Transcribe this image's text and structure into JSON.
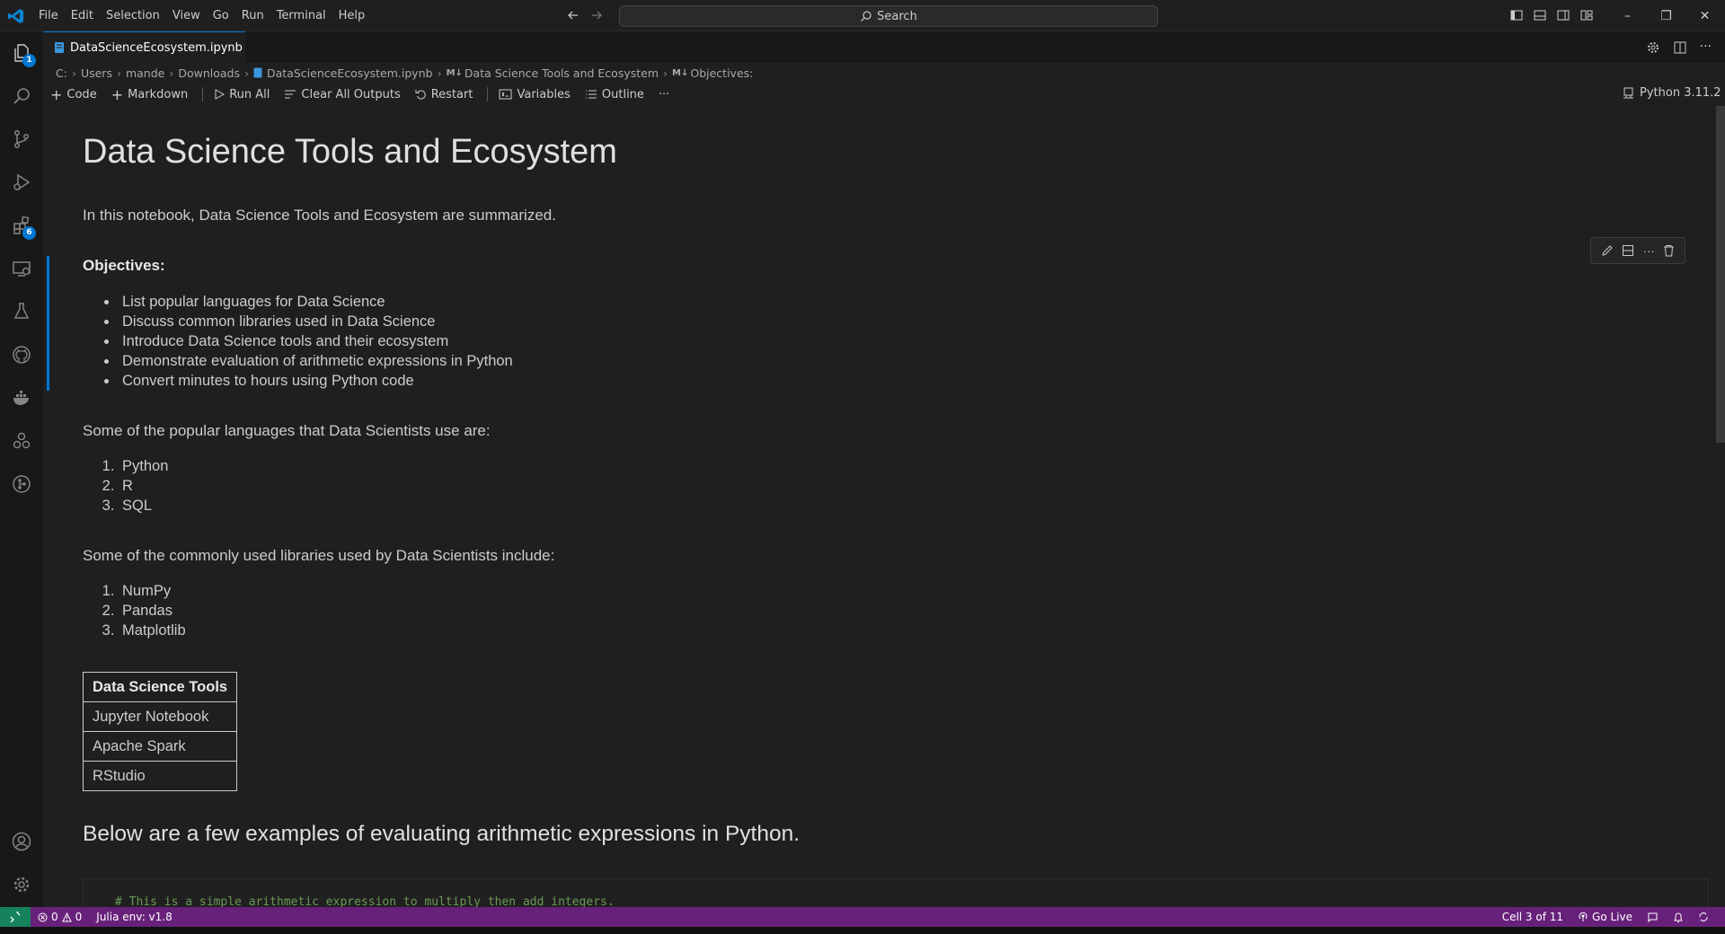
{
  "menu": [
    "File",
    "Edit",
    "Selection",
    "View",
    "Go",
    "Run",
    "Terminal",
    "Help"
  ],
  "search": {
    "label": "Search"
  },
  "window_controls": {
    "minimize": "–",
    "restore": "❐",
    "close": "✕"
  },
  "activity_badges": {
    "explorer": "1",
    "extensions": "6"
  },
  "tab": {
    "filename": "DataScienceEcosystem.ipynb"
  },
  "breadcrumb": [
    "C:",
    "Users",
    "mande",
    "Downloads",
    "DataScienceEcosystem.ipynb",
    "Data Science Tools and Ecosystem",
    "Objectives:"
  ],
  "breadcrumb_md_prefix": "M↓",
  "toolbar": {
    "code": "Code",
    "markdown": "Markdown",
    "run_all": "Run All",
    "clear_outputs": "Clear All Outputs",
    "restart": "Restart",
    "variables": "Variables",
    "outline": "Outline",
    "more": "···"
  },
  "kernel": "Python 3.11.2",
  "notebook": {
    "title": "Data Science Tools and Ecosystem",
    "intro": "In this notebook, Data Science Tools and Ecosystem are summarized.",
    "objectives_heading": "Objectives:",
    "objectives": [
      "List popular languages for Data Science",
      "Discuss common libraries used in Data Science",
      "Introduce Data Science tools and their ecosystem",
      "Demonstrate evaluation of arithmetic expressions in Python",
      "Convert minutes to hours using Python code"
    ],
    "languages_intro": "Some of the popular languages that Data Scientists use are:",
    "languages": [
      "Python",
      "R",
      "SQL"
    ],
    "libraries_intro": "Some of the commonly used libraries used by Data Scientists include:",
    "libraries": [
      "NumPy",
      "Pandas",
      "Matplotlib"
    ],
    "tools_table": {
      "header": "Data Science Tools",
      "rows": [
        "Jupyter Notebook",
        "Apache Spark",
        "RStudio"
      ]
    },
    "arith_heading": "Below are a few examples of evaluating arithmetic expressions in Python.",
    "code_comment": "# This is a simple arithmetic expression to multiply then add integers."
  },
  "status": {
    "errors": "0",
    "warnings": "0",
    "julia": "Julia env: v1.8",
    "cell": "Cell 3 of 11",
    "golive": "Go Live"
  },
  "colors": {
    "accent": "#0078d4",
    "statusbar": "#68217a",
    "remote": "#16825d"
  }
}
